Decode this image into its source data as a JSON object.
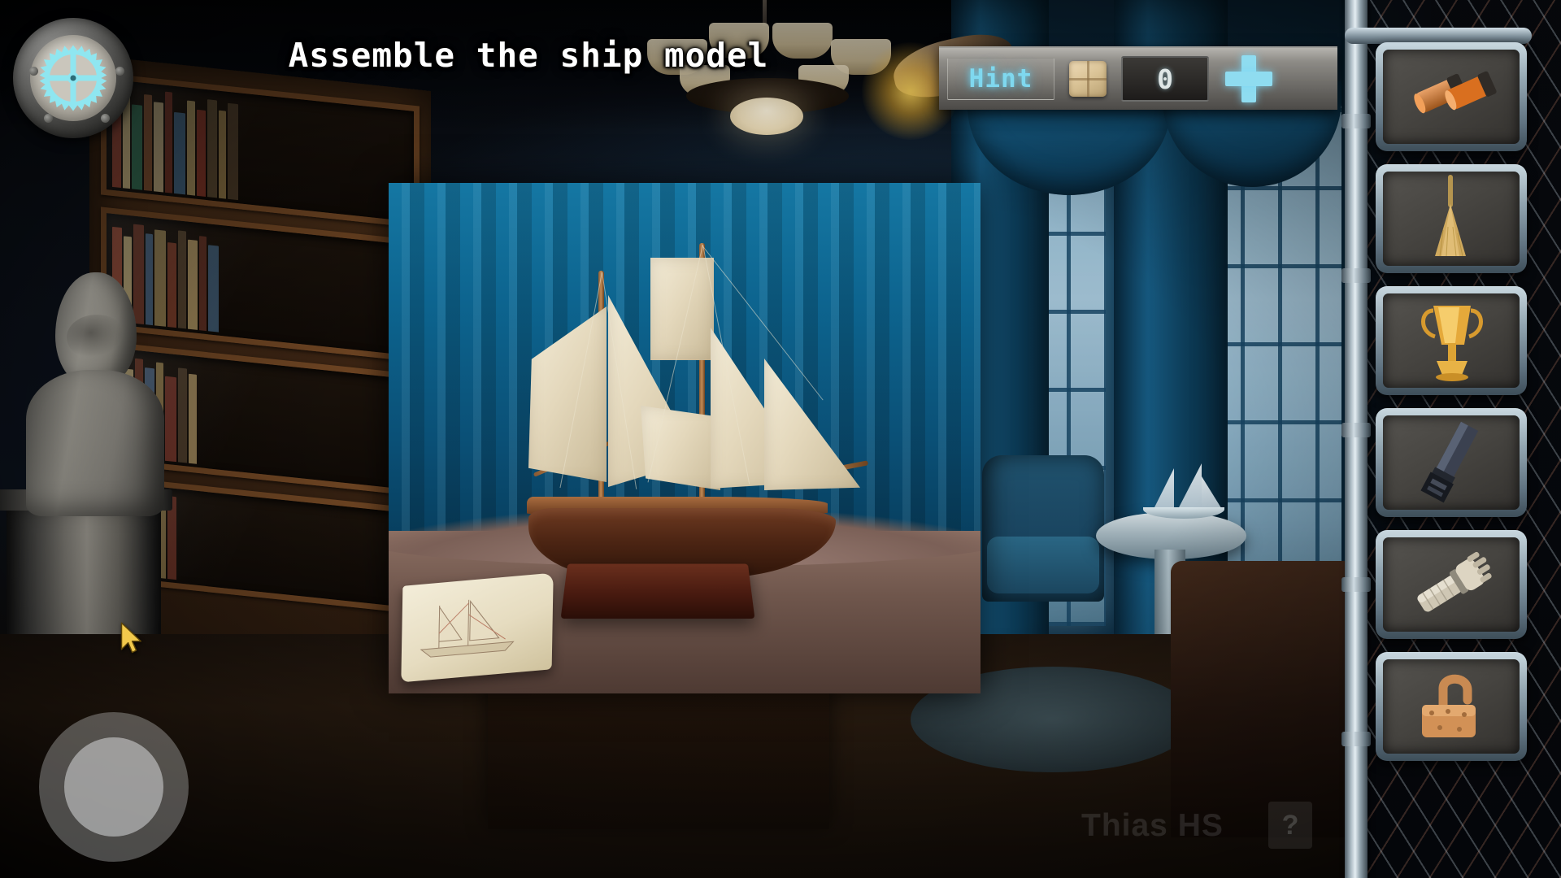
{
  "window": {
    "title": "Assemble the ship model"
  },
  "hud": {
    "settings_icon": "gear-icon",
    "hint_label": "Hint",
    "scroll_icon": "scroll-icon",
    "counter_value": "0",
    "plus_label": "+",
    "plus_icon": "plus-icon"
  },
  "closeup": {
    "name": "ship-model-closeup",
    "description": "Wooden schooner ship model on a dark wood stand in front of blue curtains, with a blueprint sheet on the table"
  },
  "inventory": {
    "scroll_up_icon": "triangle-up-icon",
    "scroll_down_icon": "triangle-down-icon",
    "items": [
      {
        "name": "shotgun-shells",
        "icon": "shells-icon",
        "label": "Shotgun shells"
      },
      {
        "name": "broom",
        "icon": "broom-icon",
        "label": "Broom"
      },
      {
        "name": "trophy",
        "icon": "trophy-icon",
        "label": "Gold trophy"
      },
      {
        "name": "scraper",
        "icon": "scraper-icon",
        "label": "Metal scraper"
      },
      {
        "name": "gauntlet",
        "icon": "gauntlet-icon",
        "label": "Armored gauntlet"
      },
      {
        "name": "open-padlock",
        "icon": "padlock-icon",
        "label": "Open padlock"
      }
    ]
  },
  "controls": {
    "joystick_label": "Movement joystick",
    "cursor_label": "Pointer"
  },
  "watermark": {
    "text": "Thias HS",
    "badge": "?"
  },
  "colors": {
    "accent_cyan": "#7fd8ef",
    "arrow_cyan": "#63d2f5",
    "panel_gray": "#8d8b86",
    "curtain_blue": "#0d6590",
    "wood_brown": "#4e2614"
  }
}
